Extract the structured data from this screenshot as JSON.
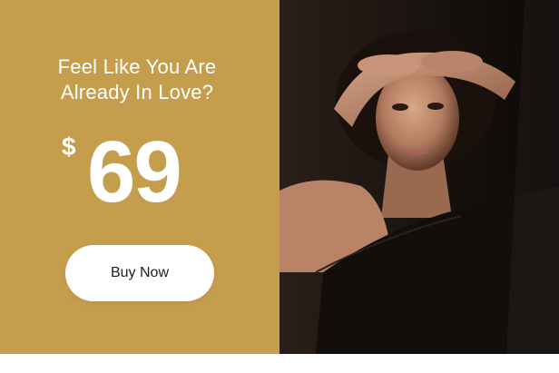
{
  "promo": {
    "headline_line1": "Feel Like You Are",
    "headline_line2": "Already In Love?",
    "currency_symbol": "$",
    "price": "69",
    "cta_label": "Buy Now"
  },
  "colors": {
    "panel_background": "#c59e4d",
    "text": "#ffffff",
    "button_background": "#ffffff",
    "button_text": "#1e1e1e"
  },
  "photo": {
    "description_icon": "woman-portrait-photo"
  }
}
